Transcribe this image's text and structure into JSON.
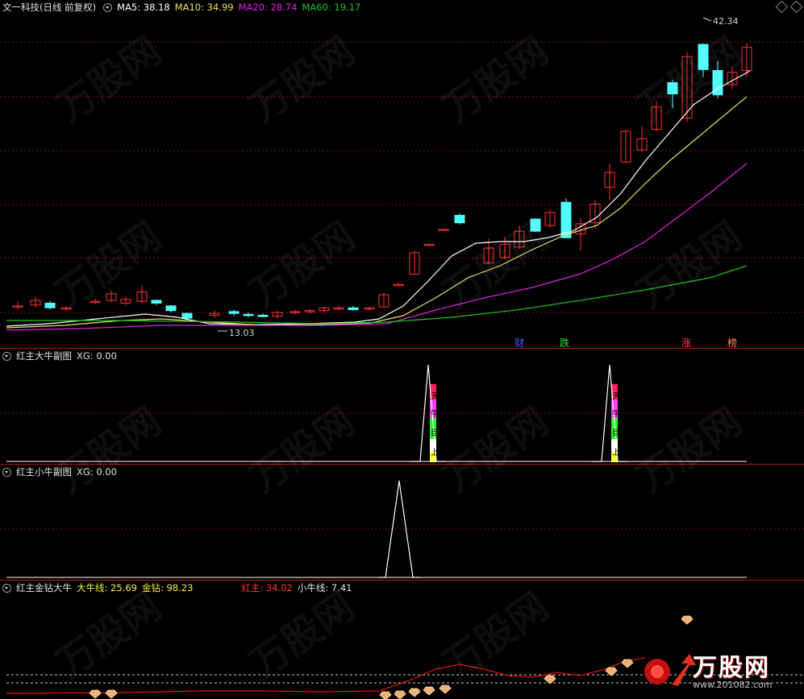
{
  "main_pane": {
    "title": "文一科技(日线 前复权)",
    "ma5_label": "MA5: 38.18",
    "ma10_label": "MA10: 34.99",
    "ma20_label": "MA20: 28.74",
    "ma60_label": "MA60: 19.17",
    "high_label": "42.34",
    "low_label": "13.03",
    "tags": [
      "财",
      "跌",
      "涨",
      "榜"
    ],
    "colors": {
      "ma5": "#ffffff",
      "ma10": "#e8e060",
      "ma20": "#e020e0",
      "ma60": "#20c020",
      "up": "#ff3030",
      "down": "#50ffff"
    }
  },
  "pane2": {
    "title": "红主大牛副图",
    "xg_label": "XG: 0.00",
    "peak_chars": [
      "天",
      "牛",
      "目",
      "上"
    ]
  },
  "pane3": {
    "title": "红主小牛副图",
    "xg_label": "XG: 0.00"
  },
  "pane4": {
    "title": "红主金钻大牛",
    "daniu_label": "大牛线: 25.69",
    "jinzuan_label": "金钻: 98.23",
    "hongzhu_label": "红主: 34.02",
    "xiaoniu_label": "小牛线: 7.41"
  },
  "watermark": {
    "brand": "万股网",
    "url": "www.201082.com"
  }
}
